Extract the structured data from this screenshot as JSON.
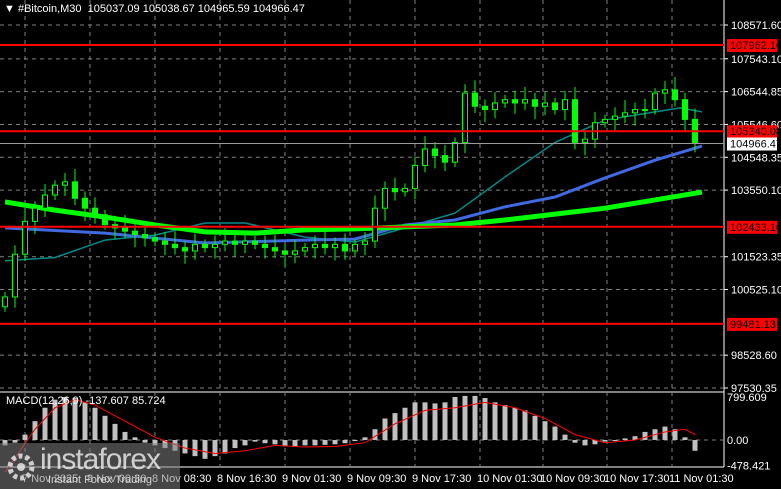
{
  "header": {
    "symbol": "#Bitcoin,M30",
    "open": "105037.09",
    "high": "105038.67",
    "low": "104965.59",
    "close": "104966.47"
  },
  "colors": {
    "background": "#000000",
    "candle": "#00ff00",
    "level": "#ff0000",
    "ma_fast": "#008b8b",
    "ma_mid": "#4169e1",
    "ma_slow": "#00ff00",
    "macd_hist": "#c0c0c0",
    "macd_signal": "#ff0000",
    "grid": "#7f7f7f"
  },
  "watermark": {
    "name": "instaforex",
    "tagline": "Instant Forex Trading"
  },
  "chart_data": [
    {
      "type": "candlestick",
      "title": "#Bitcoin,M30",
      "ylim": [
        97530.35,
        108571.6
      ],
      "y_ticks": [
        "108571.60",
        "107543.10",
        "106544.85",
        "105546.60",
        "104548.35",
        "103550.10",
        "101523.35",
        "100525.10",
        "98528.60",
        "97530.35"
      ],
      "y_tick_values": [
        108571.6,
        107543.1,
        106544.85,
        105546.6,
        104548.35,
        103550.1,
        101523.35,
        100525.1,
        98528.6,
        97530.35
      ],
      "x_ticks": [
        {
          "label": "7 Nov 2025",
          "index": 2
        },
        {
          "label": "8 Nov 00:30",
          "index": 8.5
        },
        {
          "label": "8 Nov 08:30",
          "index": 15
        },
        {
          "label": "8 Nov 16:30",
          "index": 21.5
        },
        {
          "label": "9 Nov 01:30",
          "index": 28
        },
        {
          "label": "9 Nov 09:30",
          "index": 34.5
        },
        {
          "label": "9 Nov 17:30",
          "index": 41
        },
        {
          "label": "10 Nov 01:30",
          "index": 47.5
        },
        {
          "label": "10 Nov 09:30",
          "index": 53.8
        },
        {
          "label": "10 Nov 17:30",
          "index": 60.2
        },
        {
          "label": "11 Nov 01:30",
          "index": 66.7
        }
      ],
      "closes": [
        100300,
        101600,
        102600,
        103000,
        103400,
        103700,
        103800,
        103300,
        103000,
        102800,
        102500,
        102400,
        102300,
        102200,
        102100,
        102000,
        101900,
        101800,
        101700,
        101900,
        101800,
        101900,
        102000,
        101900,
        102000,
        101900,
        101800,
        101700,
        101600,
        101700,
        101800,
        101900,
        101800,
        101900,
        101700,
        101900,
        102000,
        103000,
        103600,
        103500,
        103600,
        104300,
        104800,
        104600,
        104400,
        105000,
        106500,
        106100,
        106000,
        106200,
        106300,
        106200,
        106300,
        106100,
        106200,
        106000,
        106300,
        105000,
        105100,
        105600,
        105700,
        105800,
        105900,
        106000,
        106000,
        106500,
        106600,
        106300,
        105700,
        104966.47
      ],
      "levels": [
        {
          "label": "107962.16",
          "value": 107962.16
        },
        {
          "label": "105340.08",
          "value": 105340.08
        },
        {
          "label": "102433.16",
          "value": 102433.16
        },
        {
          "label": "99481.13",
          "value": 99481.13
        }
      ],
      "current_price": {
        "label": "104966.47",
        "value": 104966.47
      },
      "moving_averages": [
        {
          "name": "ma_fast",
          "points": [
            [
              0,
              101400
            ],
            [
              5,
              101500
            ],
            [
              10,
              102030
            ],
            [
              15,
              102180
            ],
            [
              20,
              102550
            ],
            [
              24,
              102550
            ],
            [
              30,
              102120
            ],
            [
              35,
              101970
            ],
            [
              40,
              102400
            ],
            [
              45,
              102850
            ],
            [
              50,
              103950
            ],
            [
              55,
              105000
            ],
            [
              60,
              105680
            ],
            [
              65,
              105930
            ],
            [
              67.5,
              106050
            ],
            [
              69.7,
              105930
            ]
          ]
        },
        {
          "name": "ma_mid",
          "points": [
            [
              0,
              102400
            ],
            [
              10,
              102240
            ],
            [
              20,
              101940
            ],
            [
              30,
              102030
            ],
            [
              35,
              102060
            ],
            [
              40,
              102490
            ],
            [
              45,
              102640
            ],
            [
              50,
              103040
            ],
            [
              55,
              103340
            ],
            [
              60,
              103920
            ],
            [
              65,
              104460
            ],
            [
              69.7,
              104890
            ]
          ]
        },
        {
          "name": "ma_slow",
          "points": [
            [
              0,
              103190
            ],
            [
              5,
              102940
            ],
            [
              10,
              102730
            ],
            [
              15,
              102490
            ],
            [
              20,
              102280
            ],
            [
              25,
              102240
            ],
            [
              30,
              102340
            ],
            [
              35,
              102370
            ],
            [
              40,
              102430
            ],
            [
              45,
              102490
            ],
            [
              50,
              102640
            ],
            [
              55,
              102820
            ],
            [
              60,
              103000
            ],
            [
              65,
              103250
            ],
            [
              69.7,
              103490
            ]
          ]
        }
      ]
    },
    {
      "type": "bar",
      "title": "MACD(12,26,9)",
      "label": "MACD(12,26,9) -137.607 85.724",
      "ylim": [
        -478.421,
        799.609
      ],
      "y_ticks": [
        "799.609",
        "0.00",
        "-478.421"
      ],
      "y_tick_values": [
        799.609,
        0,
        -478.421
      ],
      "histogram": [
        -100,
        -50,
        100,
        350,
        600,
        750,
        800,
        780,
        700,
        600,
        450,
        300,
        150,
        50,
        -50,
        -100,
        -150,
        -200,
        -250,
        -300,
        -350,
        -300,
        -250,
        -150,
        -100,
        -30,
        -60,
        -80,
        -120,
        -130,
        -100,
        -100,
        -90,
        -80,
        -60,
        -20,
        50,
        200,
        400,
        500,
        600,
        700,
        700,
        680,
        700,
        800,
        820,
        820,
        780,
        700,
        650,
        600,
        550,
        450,
        350,
        250,
        100,
        -50,
        -100,
        -80,
        -30,
        0,
        30,
        70,
        150,
        200,
        250,
        200,
        50,
        -200
      ],
      "signal_points": [
        [
          0,
          -600
        ],
        [
          3,
          200
        ],
        [
          5,
          600
        ],
        [
          7,
          750
        ],
        [
          9,
          650
        ],
        [
          12,
          350
        ],
        [
          15,
          50
        ],
        [
          18,
          -150
        ],
        [
          21,
          -250
        ],
        [
          24,
          -200
        ],
        [
          27,
          -100
        ],
        [
          30,
          -130
        ],
        [
          33,
          -120
        ],
        [
          36,
          -50
        ],
        [
          39,
          300
        ],
        [
          42,
          550
        ],
        [
          45,
          600
        ],
        [
          48,
          700
        ],
        [
          51,
          600
        ],
        [
          54,
          400
        ],
        [
          57,
          100
        ],
        [
          60,
          -50
        ],
        [
          63,
          0
        ],
        [
          66,
          150
        ],
        [
          68,
          200
        ],
        [
          69,
          100
        ]
      ]
    }
  ]
}
